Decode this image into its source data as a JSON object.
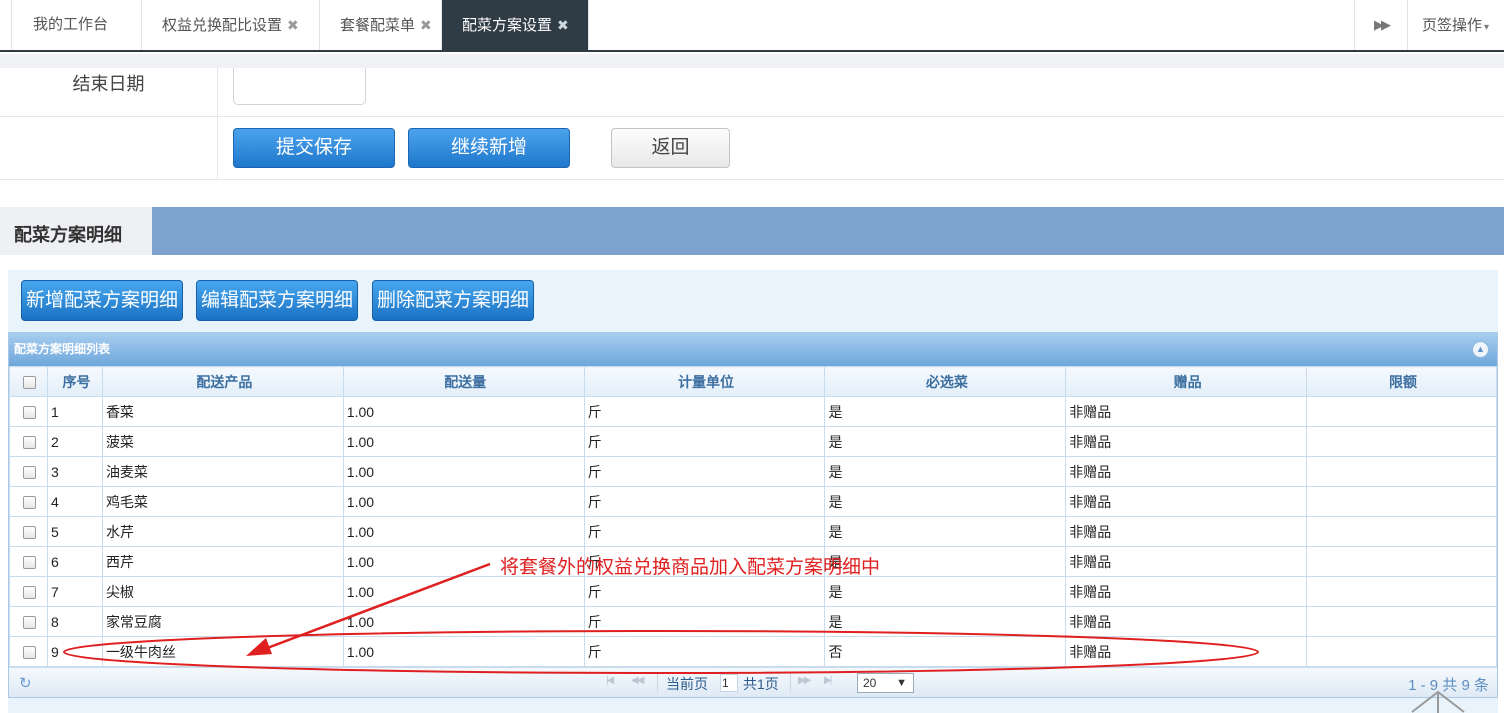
{
  "tabs": {
    "items": [
      {
        "label": "我的工作台",
        "closable": false,
        "active": false
      },
      {
        "label": "权益兑换配比设置",
        "closable": true,
        "active": false
      },
      {
        "label": "套餐配菜单",
        "closable": true,
        "active": false
      },
      {
        "label": "配菜方案设置",
        "closable": true,
        "active": true
      }
    ],
    "close_glyph": "✖",
    "next_glyph": "▶▶",
    "ops_label": "页签操作",
    "ops_caret": "▾"
  },
  "form": {
    "end_date_label": "结束日期",
    "end_date_value": "",
    "submit_label": "提交保存",
    "continue_label": "继续新增",
    "back_label": "返回"
  },
  "detail": {
    "section_title": "配菜方案明细",
    "add_label": "新增配菜方案明细",
    "edit_label": "编辑配菜方案明细",
    "delete_label": "删除配菜方案明细"
  },
  "grid": {
    "caption": "配菜方案明细列表",
    "columns": [
      "序号",
      "配送产品",
      "配送量",
      "计量单位",
      "必选菜",
      "赠品",
      "限额"
    ],
    "rows": [
      {
        "no": "1",
        "product": "香菜",
        "qty": "1.00",
        "unit": "斤",
        "required": "是",
        "gift": "非赠品",
        "limit": ""
      },
      {
        "no": "2",
        "product": "菠菜",
        "qty": "1.00",
        "unit": "斤",
        "required": "是",
        "gift": "非赠品",
        "limit": ""
      },
      {
        "no": "3",
        "product": "油麦菜",
        "qty": "1.00",
        "unit": "斤",
        "required": "是",
        "gift": "非赠品",
        "limit": ""
      },
      {
        "no": "4",
        "product": "鸡毛菜",
        "qty": "1.00",
        "unit": "斤",
        "required": "是",
        "gift": "非赠品",
        "limit": ""
      },
      {
        "no": "5",
        "product": "水芹",
        "qty": "1.00",
        "unit": "斤",
        "required": "是",
        "gift": "非赠品",
        "limit": ""
      },
      {
        "no": "6",
        "product": "西芹",
        "qty": "1.00",
        "unit": "斤",
        "required": "是",
        "gift": "非赠品",
        "limit": ""
      },
      {
        "no": "7",
        "product": "尖椒",
        "qty": "1.00",
        "unit": "斤",
        "required": "是",
        "gift": "非赠品",
        "limit": ""
      },
      {
        "no": "8",
        "product": "家常豆腐",
        "qty": "1.00",
        "unit": "斤",
        "required": "是",
        "gift": "非赠品",
        "limit": ""
      },
      {
        "no": "9",
        "product": "一级牛肉丝",
        "qty": "1.00",
        "unit": "斤",
        "required": "否",
        "gift": "非赠品",
        "limit": ""
      }
    ],
    "pager": {
      "current_page_label": "当前页",
      "current_page_value": "1",
      "total_pages": "共1页",
      "page_size": "20",
      "range": "1 - 9  共 9 条"
    }
  },
  "annotation": {
    "text": "将套餐外的权益兑换商品加入配菜方案明细中",
    "color": "#e02020"
  },
  "colors": {
    "active_tab_bg": "#2f3b45",
    "section_bar": "#7fa3cf",
    "primary_button": "#1f77cc",
    "grid_header_text": "#3d6fa0"
  }
}
